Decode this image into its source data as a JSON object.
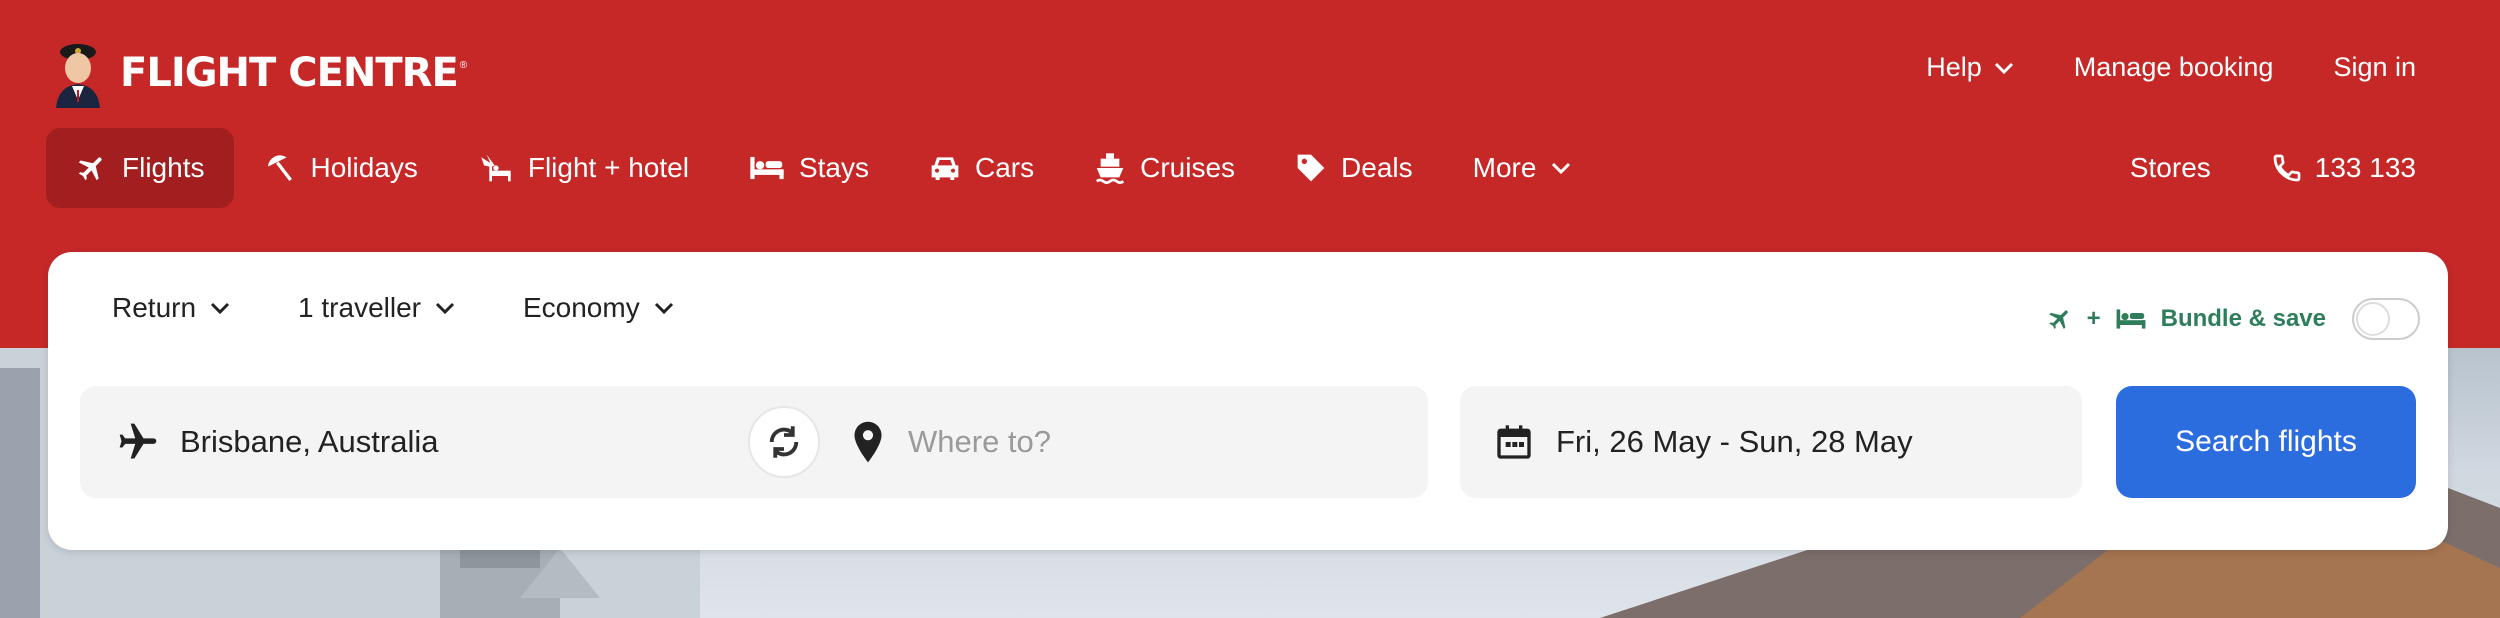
{
  "brand": {
    "name": "FLIGHT CENTRE",
    "reg": "®"
  },
  "toplinks": {
    "help": "Help",
    "manage": "Manage booking",
    "signin": "Sign in"
  },
  "nav": {
    "items": [
      {
        "label": "Flights",
        "icon": "plane-icon",
        "active": true
      },
      {
        "label": "Holidays",
        "icon": "beach-umbrella-icon"
      },
      {
        "label": "Flight + hotel",
        "icon": "plane-bed-icon"
      },
      {
        "label": "Stays",
        "icon": "bed-icon"
      },
      {
        "label": "Cars",
        "icon": "car-icon"
      },
      {
        "label": "Cruises",
        "icon": "ship-icon"
      },
      {
        "label": "Deals",
        "icon": "tag-icon"
      },
      {
        "label": "More",
        "icon": "chevron-down-icon"
      }
    ],
    "stores": "Stores",
    "phone": "133 133"
  },
  "search": {
    "trip_type": "Return",
    "travellers": "1 traveller",
    "cabin": "Economy",
    "bundle_plus": "+",
    "bundle_label": "Bundle & save",
    "bundle_on": false,
    "from": "Brisbane, Australia",
    "to_placeholder": "Where to?",
    "dates": "Fri, 26 May - Sun, 28 May",
    "button": "Search flights"
  },
  "colors": {
    "brand_red": "#c62828",
    "active_red": "#a31f1f",
    "button_blue": "#2b6cdf",
    "bundle_green": "#2e7d5b"
  }
}
